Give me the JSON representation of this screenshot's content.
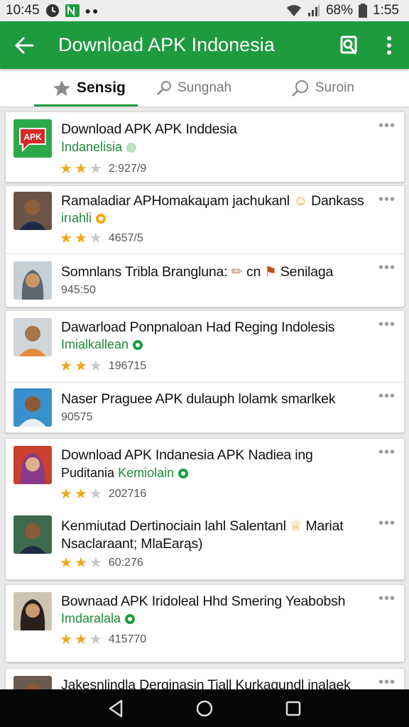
{
  "status_bar": {
    "time_left": "10:45",
    "battery_percent": "68%",
    "time_right": "1:55"
  },
  "app_bar": {
    "title": "Download APK Indonesia"
  },
  "tabs": [
    {
      "label": "Sensig",
      "icon": "star-icon",
      "active": true
    },
    {
      "label": "Sungnah",
      "icon": "pin-icon",
      "active": false
    },
    {
      "label": "Suroin",
      "icon": "search-icon",
      "active": false
    }
  ],
  "feed": {
    "c1r1": {
      "title": "Download APK APK Inddesia",
      "subtitle": "Indanelisia",
      "rating_count": "2:927/9",
      "stars": 2,
      "thumb_text": "APK"
    },
    "c2r1": {
      "title": "Ramaladiar APHomakaџam jachukanl",
      "title_suffix": "Dankass",
      "subtitle": "irıahli",
      "rating_count": "4657/5",
      "stars": 2
    },
    "c2r2": {
      "title": "Somnlans Tribla Brangluna:",
      "title_suffix": "cn",
      "title_suffix2": "Senilaga",
      "meta": "945:50"
    },
    "c3r1": {
      "title": "Dawarload Ponpnaloan Had Reging Indolesis",
      "subtitle": "Imialkallean",
      "rating_count": "196715",
      "stars": 2
    },
    "c3r2": {
      "title": "Naser Praguee APK dulauph lolamk smarlkek",
      "meta": "90575"
    },
    "c4r1": {
      "title": "Download APK Indanesia APK Nadiea ing",
      "subtitle_prefix": "Puditania",
      "subtitle": "Kemiolain",
      "rating_count": "202716",
      "stars": 2
    },
    "c4r2": {
      "title": "Kenmiutad Dertinociain lahl Salentanl",
      "title_suffix": "Mariat",
      "line2": "Nsaclaraant; MlaEarąs)",
      "rating_count": "60:276",
      "stars": 2
    },
    "c5r1": {
      "title": "Bownaad APK Iridoleal Hhd Smering Yeabobsh",
      "subtitle": "Imdaralala",
      "rating_count": "415770",
      "stars": 2
    },
    "c6r1": {
      "title": "Jakesnlindla Derginasin Tiall Kurkagundl inalaek"
    }
  },
  "colors": {
    "accent": "#1e9b3f",
    "star": "#f0a81c",
    "subtitle_green": "#1e8a38"
  }
}
